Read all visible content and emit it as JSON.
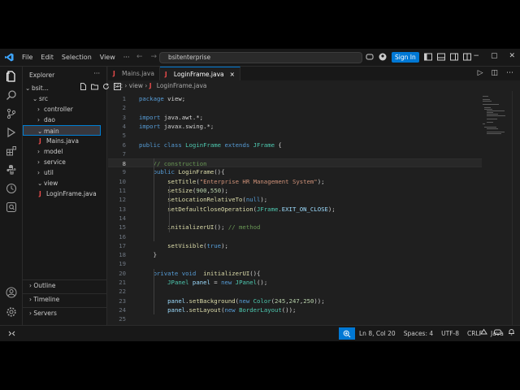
{
  "colors": {
    "accent": "#0078d4",
    "java_icon": "#e94b4b",
    "background": "#1f1f1f"
  },
  "titlebar": {
    "menu": [
      "File",
      "Edit",
      "Selection",
      "View"
    ],
    "more": "···",
    "search_text": "bsitenterprise",
    "sign_in": "Sign In"
  },
  "sidebar": {
    "title": "Explorer",
    "more": "···",
    "root": "bsit...",
    "tree": [
      {
        "label": "src",
        "indent": 1,
        "chevron": "⌄"
      },
      {
        "label": "controller",
        "indent": 2,
        "chevron": "›"
      },
      {
        "label": "dao",
        "indent": 2,
        "chevron": "›"
      },
      {
        "label": "main",
        "indent": 2,
        "chevron": "⌄"
      },
      {
        "label": "Mains.java",
        "indent": 3,
        "java": true
      },
      {
        "label": "model",
        "indent": 2,
        "chevron": "›"
      },
      {
        "label": "service",
        "indent": 2,
        "chevron": "›"
      },
      {
        "label": "util",
        "indent": 2,
        "chevron": "›"
      },
      {
        "label": "view",
        "indent": 2,
        "chevron": "⌄"
      },
      {
        "label": "LoginFrame.java",
        "indent": 3,
        "java": true
      }
    ],
    "outline": "Outline",
    "timeline": "Timeline",
    "servers": "Servers"
  },
  "tabs": [
    {
      "label": "Mains.java",
      "active": false
    },
    {
      "label": "LoginFrame.java",
      "active": true,
      "close": "×"
    }
  ],
  "breadcrumb": {
    "parts": [
      "src",
      "view",
      "LoginFrame.java"
    ],
    "sep": "›"
  },
  "editor": {
    "current_line": 8,
    "lines": [
      [
        [
          "kw",
          "package"
        ],
        [
          "pl",
          " view;"
        ]
      ],
      [],
      [
        [
          "kw",
          "import"
        ],
        [
          "pl",
          " java.awt.*;"
        ]
      ],
      [
        [
          "kw",
          "import"
        ],
        [
          "pl",
          " javax.swing.*;"
        ]
      ],
      [],
      [
        [
          "kw",
          "public"
        ],
        [
          "pl",
          " "
        ],
        [
          "kw",
          "class"
        ],
        [
          "pl",
          " "
        ],
        [
          "ty",
          "LoginFrame"
        ],
        [
          "pl",
          " "
        ],
        [
          "kw",
          "extends"
        ],
        [
          "pl",
          " "
        ],
        [
          "ty",
          "JFrame"
        ],
        [
          "pl",
          " {"
        ]
      ],
      [],
      [
        [
          "pl",
          "    "
        ],
        [
          "cm",
          "// construction"
        ]
      ],
      [
        [
          "pl",
          "    "
        ],
        [
          "kw",
          "public"
        ],
        [
          "pl",
          " "
        ],
        [
          "fn",
          "LoginFrame"
        ],
        [
          "pl",
          "(){"
        ]
      ],
      [
        [
          "pl",
          "        "
        ],
        [
          "fn",
          "setTitle"
        ],
        [
          "pl",
          "("
        ],
        [
          "st",
          "\"Enterprise HR Management System\""
        ],
        [
          "pl",
          ");"
        ]
      ],
      [
        [
          "pl",
          "        "
        ],
        [
          "fn",
          "setSize"
        ],
        [
          "pl",
          "("
        ],
        [
          "nm",
          "900"
        ],
        [
          "pl",
          ","
        ],
        [
          "nm",
          "550"
        ],
        [
          "pl",
          ");"
        ]
      ],
      [
        [
          "pl",
          "        "
        ],
        [
          "fn",
          "setLocationRelativeTo"
        ],
        [
          "pl",
          "("
        ],
        [
          "kw",
          "null"
        ],
        [
          "pl",
          ");"
        ]
      ],
      [
        [
          "pl",
          "        "
        ],
        [
          "fn",
          "setDefaultCloseOperation"
        ],
        [
          "pl",
          "("
        ],
        [
          "ty",
          "JFrame"
        ],
        [
          "pl",
          "."
        ],
        [
          "vr",
          "EXIT_ON_CLOSE"
        ],
        [
          "pl",
          ");"
        ]
      ],
      [],
      [
        [
          "pl",
          "        "
        ],
        [
          "fn",
          "initializerUI"
        ],
        [
          "pl",
          "(); "
        ],
        [
          "cm",
          "// method"
        ]
      ],
      [],
      [
        [
          "pl",
          "        "
        ],
        [
          "fn",
          "setVisible"
        ],
        [
          "pl",
          "("
        ],
        [
          "kw",
          "true"
        ],
        [
          "pl",
          ");"
        ]
      ],
      [
        [
          "pl",
          "    }"
        ]
      ],
      [],
      [
        [
          "pl",
          "    "
        ],
        [
          "kw",
          "private"
        ],
        [
          "pl",
          " "
        ],
        [
          "kw",
          "void"
        ],
        [
          "pl",
          "  "
        ],
        [
          "fn",
          "initializerUI"
        ],
        [
          "pl",
          "(){"
        ]
      ],
      [
        [
          "pl",
          "        "
        ],
        [
          "ty",
          "JPanel"
        ],
        [
          "pl",
          " "
        ],
        [
          "vr",
          "panel"
        ],
        [
          "pl",
          " = "
        ],
        [
          "kw",
          "new"
        ],
        [
          "pl",
          " "
        ],
        [
          "ty",
          "JPanel"
        ],
        [
          "pl",
          "();"
        ]
      ],
      [],
      [
        [
          "pl",
          "        "
        ],
        [
          "vr",
          "panel"
        ],
        [
          "pl",
          "."
        ],
        [
          "fn",
          "setBackground"
        ],
        [
          "pl",
          "("
        ],
        [
          "kw",
          "new"
        ],
        [
          "pl",
          " "
        ],
        [
          "ty",
          "Color"
        ],
        [
          "pl",
          "("
        ],
        [
          "nm",
          "245"
        ],
        [
          "pl",
          ","
        ],
        [
          "nm",
          "247"
        ],
        [
          "pl",
          ","
        ],
        [
          "nm",
          "250"
        ],
        [
          "pl",
          "));"
        ]
      ],
      [
        [
          "pl",
          "        "
        ],
        [
          "vr",
          "panel"
        ],
        [
          "pl",
          "."
        ],
        [
          "fn",
          "setLayout"
        ],
        [
          "pl",
          "("
        ],
        [
          "kw",
          "new"
        ],
        [
          "pl",
          " "
        ],
        [
          "ty",
          "BorderLayout"
        ],
        [
          "pl",
          "());"
        ]
      ],
      []
    ]
  },
  "status": {
    "position": "Ln 8, Col 20",
    "spaces": "Spaces: 4",
    "encoding": "UTF-8",
    "eol": "CRLF",
    "language": "Java"
  }
}
